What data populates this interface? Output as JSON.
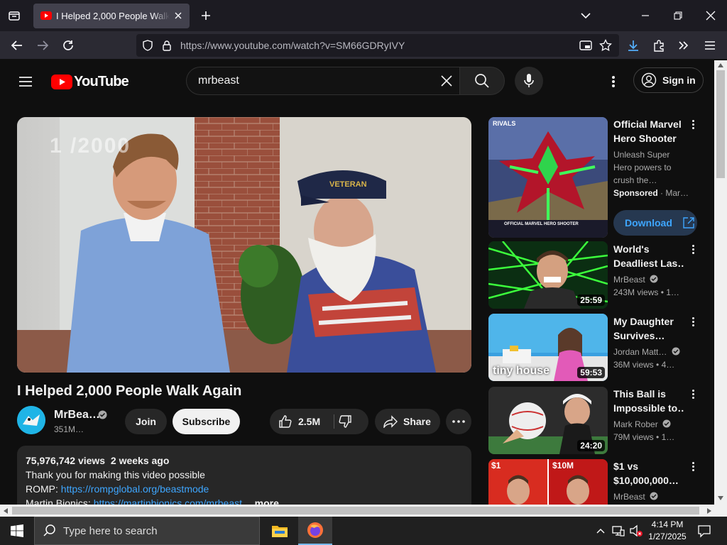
{
  "browser": {
    "tab_title": "I Helped 2,000 People Walk Again",
    "url": "https://www.youtube.com/watch?v=SM66GDRyIVY"
  },
  "youtube": {
    "logo_text": "YouTube",
    "search_value": "mrbeast",
    "sign_in_label": "Sign in"
  },
  "video": {
    "overlay_text": "1 /2000",
    "title": "I Helped 2,000 People Walk Again",
    "channel_name": "MrBea…",
    "subscribers": "351M…",
    "join_label": "Join",
    "subscribe_label": "Subscribe",
    "likes": "2.5M",
    "share_label": "Share",
    "views": "75,976,742 views",
    "age": "2 weeks ago",
    "desc_line1": "Thank you for making this video possible",
    "desc_line2_label": "ROMP: ",
    "desc_line2_link": "https://rompglobal.org/beastmode",
    "desc_line3_label": "Martin Bionics: ",
    "desc_line3_link": "https://martinbionics.com/mrbeast",
    "more_label": "...more"
  },
  "related": [
    {
      "title1": "Official Marvel",
      "title2": "Hero Shooter",
      "meta1": "Unleash Super",
      "meta2": "Hero powers to",
      "meta3": "crush the…",
      "sponsored": "Sponsored",
      "sponsor_name": "Mar…",
      "cta": "Download",
      "thumb_text": "RIVALS",
      "thumb_caption": "OFFICIAL MARVEL HERO SHOOTER"
    },
    {
      "title1": "World's",
      "title2": "Deadliest Las…",
      "channel": "MrBeast",
      "views": "243M views",
      "age": "1…",
      "duration": "25:59"
    },
    {
      "title1": "My Daughter",
      "title2": "Survives…",
      "channel": "Jordan Matt…",
      "views": "36M views",
      "age": "4…",
      "duration": "59:53",
      "thumb_text": "tiny house"
    },
    {
      "title1": "This Ball is",
      "title2": "Impossible to…",
      "channel": "Mark Rober",
      "views": "79M views",
      "age": "1…",
      "duration": "24:20"
    },
    {
      "title1": "$1 vs",
      "title2": "$10,000,000…",
      "channel": "MrBeast",
      "thumb_left": "$1",
      "thumb_right": "$10M"
    }
  ],
  "taskbar": {
    "search_placeholder": "Type here to search",
    "time": "4:14 PM",
    "date": "1/27/2025"
  },
  "colors": {
    "brand_red": "#ff0000",
    "link_blue": "#3ea6ff",
    "accent_blue": "#3ea6ff"
  }
}
